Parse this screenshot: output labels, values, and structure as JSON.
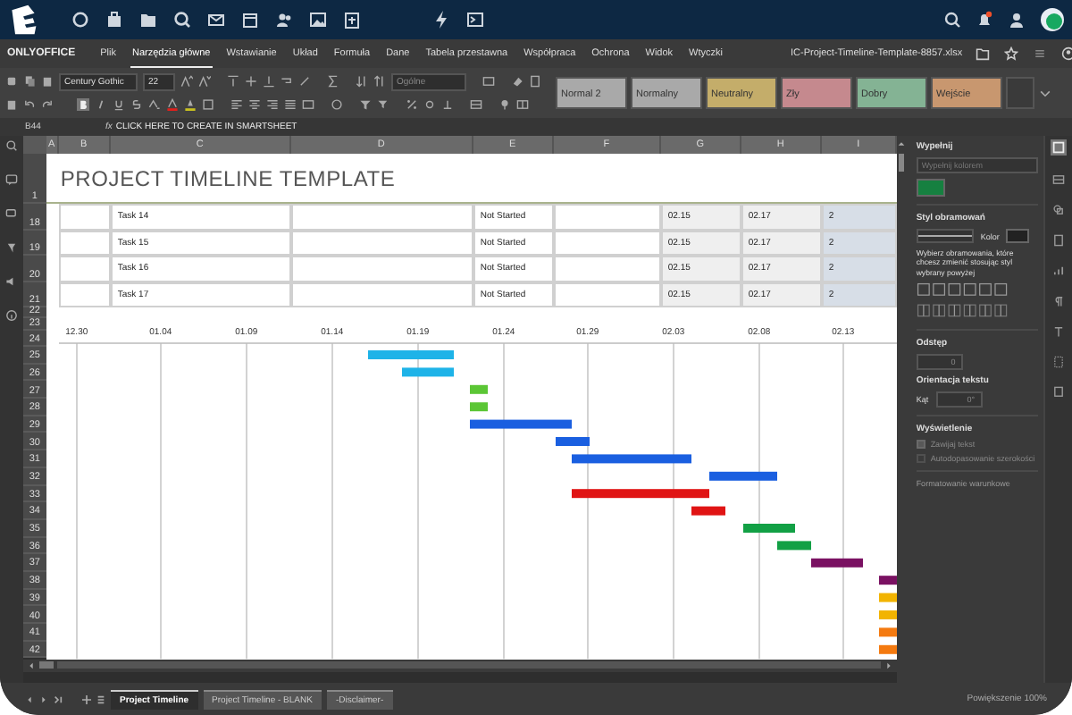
{
  "menu": {
    "brand": "ONLYOFFICE",
    "tabs": [
      {
        "label": "Plik",
        "selected": false
      },
      {
        "label": "Narzędzia główne",
        "selected": true
      },
      {
        "label": "Wstawianie",
        "selected": false
      },
      {
        "label": "Układ",
        "selected": false
      },
      {
        "label": "Formuła",
        "selected": false
      },
      {
        "label": "Dane",
        "selected": false
      },
      {
        "label": "Tabela przestawna",
        "selected": false
      },
      {
        "label": "Współpraca",
        "selected": false
      },
      {
        "label": "Ochrona",
        "selected": false
      },
      {
        "label": "Widok",
        "selected": false
      },
      {
        "label": "Wtyczki",
        "selected": false
      }
    ],
    "file_name": "IC-Project-Timeline-Template-8857.xlsx"
  },
  "toolbar": {
    "font": "Century Gothic",
    "font_size": "22",
    "number_format": "Ogólne",
    "styles": [
      {
        "label": "Normal 2",
        "color": "#a9a9a9"
      },
      {
        "label": "Normalny",
        "color": "#a9a9a9"
      },
      {
        "label": "Neutralny",
        "color": "#c4ad6a"
      },
      {
        "label": "Zły",
        "color": "#c5898e"
      },
      {
        "label": "Dobry",
        "color": "#84b394"
      },
      {
        "label": "Wejście",
        "color": "#c8976f"
      }
    ]
  },
  "formula_bar": {
    "cell": "B44",
    "fx": "fx",
    "value": "CLICK HERE TO CREATE IN SMARTSHEET"
  },
  "sheet": {
    "columns": [
      "A",
      "B",
      "C",
      "D",
      "E",
      "F",
      "G",
      "H",
      "I"
    ],
    "title_row": "1",
    "title": "PROJECT TIMELINE TEMPLATE",
    "rows": [
      {
        "row": "18",
        "cells": [
          "",
          "Task 14",
          "",
          "Not Started",
          "",
          "02.15",
          "02.17",
          "2"
        ]
      },
      {
        "row": "19",
        "cells": [
          "",
          "Task 15",
          "",
          "Not Started",
          "",
          "02.15",
          "02.17",
          "2"
        ]
      },
      {
        "row": "20",
        "cells": [
          "",
          "Task 16",
          "",
          "Not Started",
          "",
          "02.15",
          "02.17",
          "2"
        ]
      },
      {
        "row": "21",
        "cells": [
          "",
          "Task 17",
          "",
          "Not Started",
          "",
          "02.15",
          "02.17",
          "2"
        ]
      }
    ],
    "gantt_rows": [
      "22",
      "23",
      "24",
      "25",
      "26",
      "27",
      "28",
      "29",
      "30",
      "31",
      "32",
      "33",
      "34",
      "35",
      "36",
      "37",
      "38",
      "39",
      "40",
      "41",
      "42"
    ],
    "axis_labels": [
      "12.30",
      "01.04",
      "01.09",
      "01.14",
      "01.19",
      "01.24",
      "01.29",
      "02.03",
      "02.08",
      "02.13"
    ]
  },
  "panel": {
    "fill_title": "Wypełnij",
    "fill_mode": "Wypełnij kolorem",
    "border_title": "Styl obramowań",
    "border_color_label": "Kolor",
    "border_hint": "Wybierz obramowania, które chcesz zmienić stosując styl wybrany powyżej",
    "indent_title": "Odstęp",
    "indent_value": "0",
    "orientation_title": "Orientacja tekstu",
    "angle_label": "Kąt",
    "angle_value": "0°",
    "display_title": "Wyświetlenie",
    "options": [
      {
        "label": "Zawijaj tekst",
        "checked": true,
        "disabled": true
      },
      {
        "label": "Autodopasowanie szerokości",
        "checked": false,
        "disabled": true
      }
    ],
    "conditional": "Formatowanie warunkowe"
  },
  "sheet_tabs": [
    {
      "label": "Project Timeline",
      "selected": true
    },
    {
      "label": "Project Timeline - BLANK",
      "selected": false
    },
    {
      "label": "-Disclaimer-",
      "selected": false
    }
  ],
  "zoom": "Powiększenie 100%"
}
